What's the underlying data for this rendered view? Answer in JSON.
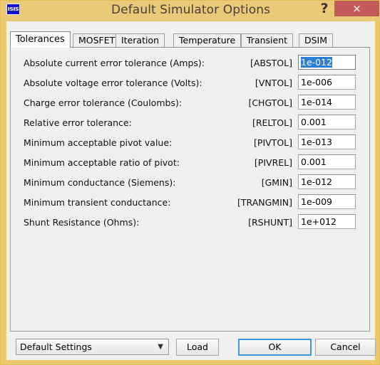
{
  "window": {
    "title": "Default Simulator Options",
    "app_icon_label": "ISIS",
    "help_label": "?",
    "close_label": "×",
    "accent_titlebar": "#eac979",
    "accent_close": "#c35b5b",
    "accent_focus": "#3c9ada",
    "accent_selection": "#2b7fd4"
  },
  "tabs": [
    {
      "label": "Tolerances",
      "active": true
    },
    {
      "label": "MOSFET",
      "active": false
    },
    {
      "label": "Iteration",
      "active": false
    },
    {
      "label": "Temperature",
      "active": false
    },
    {
      "label": "Transient",
      "active": false
    },
    {
      "label": "DSIM",
      "active": false
    }
  ],
  "rows": [
    {
      "label": "Absolute current error tolerance (Amps):",
      "tag": "[ABSTOL]",
      "value": "1e-012",
      "focused": true
    },
    {
      "label": "Absolute voltage error tolerance (Volts):",
      "tag": "[VNTOL]",
      "value": "1e-006",
      "focused": false
    },
    {
      "label": "Charge error tolerance (Coulombs):",
      "tag": "[CHGTOL]",
      "value": "1e-014",
      "focused": false
    },
    {
      "label": "Relative error tolerance:",
      "tag": "[RELTOL]",
      "value": "0.001",
      "focused": false
    },
    {
      "label": "Minimum acceptable pivot value:",
      "tag": "[PIVTOL]",
      "value": "1e-013",
      "focused": false
    },
    {
      "label": "Minimum acceptable ratio of pivot:",
      "tag": "[PIVREL]",
      "value": "0.001",
      "focused": false
    },
    {
      "label": "Minimum conductance (Siemens):",
      "tag": "[GMIN]",
      "value": "1e-012",
      "focused": false
    },
    {
      "label": "Minimum transient conductance:",
      "tag": "[TRANGMIN]",
      "value": "1e-009",
      "focused": false
    },
    {
      "label": "Shunt Resistance (Ohms):",
      "tag": "[RSHUNT]",
      "value": "1e+012",
      "focused": false
    }
  ],
  "footer": {
    "preset_value": "Default Settings",
    "preset_arrow": "▼",
    "load_label": "Load",
    "ok_label": "OK",
    "cancel_label": "Cancel"
  }
}
